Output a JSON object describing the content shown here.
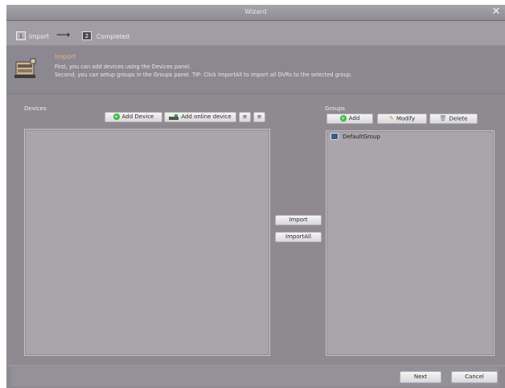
{
  "window": {
    "title": "Wizard",
    "close_glyph": "✕"
  },
  "steps": {
    "step1_num": "1",
    "step1_label": "Import",
    "arrow": "⟶",
    "step2_num": "2",
    "step2_label": "Completed"
  },
  "info": {
    "title": "Import",
    "line1": "First, you can add devices using the Devices panel.",
    "line2": "Second, you can setup groups in the Groups panel. TIP: Click ImportAll to import all DVRs to the selected group.",
    "icon": "device-box-icon"
  },
  "devices": {
    "label": "Devices",
    "add_device": "Add Device",
    "add_online_device": "Add online device",
    "filter_glyph": "≡",
    "filter2_glyph": "≡"
  },
  "import": {
    "import_label": "Import",
    "import_all_label": "ImportAll"
  },
  "groups": {
    "label": "Groups",
    "add": "Add",
    "modify": "Modify",
    "delete": "Delete",
    "items": [
      "DefaultGroup"
    ]
  },
  "footer": {
    "next": "Next",
    "cancel": "Cancel"
  },
  "colors": {
    "window_bg": "#8e8a90",
    "panel_bg": "#a9a5ab",
    "info_title": "#e1b476",
    "add_green": "#38b83c"
  }
}
